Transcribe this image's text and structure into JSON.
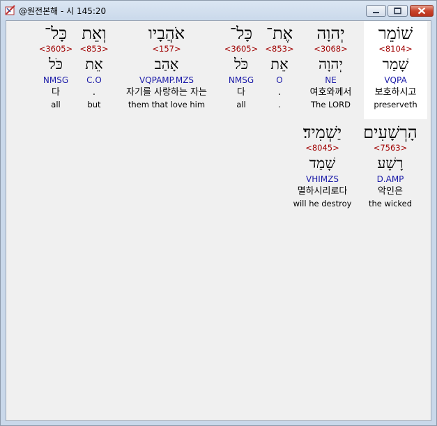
{
  "window": {
    "title": "@원전본해 - 시 145:20",
    "icon": "bible-tool-icon",
    "buttons": {
      "minimize": "minimize-icon",
      "maximize": "maximize-icon",
      "close": "close-icon"
    }
  },
  "words": [
    {
      "hebrew": "שׁוֹמֵר",
      "strong": "<8104>",
      "lemma": "שָׁמַר",
      "morph": "VQPA",
      "korean": "보호하시고",
      "english": "preserveth",
      "selected": true
    },
    {
      "hebrew": "יְהוָה",
      "strong": "<3068>",
      "lemma": "יְהוָה",
      "morph": "NE",
      "korean": "여호와께서",
      "english": "The LORD"
    },
    {
      "hebrew": "אֶת־",
      "strong": "<853>",
      "lemma": "אֵת",
      "morph": "O",
      "korean": ".",
      "english": "."
    },
    {
      "hebrew": "כָּל־",
      "strong": "<3605>",
      "lemma": "כֹּל",
      "morph": "NMSG",
      "korean": "다",
      "english": "all"
    },
    {
      "hebrew": "אֹהֲבָיו",
      "strong": "<157>",
      "lemma": "אָהַב",
      "morph": "VQPAMP.MZS",
      "korean": "자기를 사랑하는 자는",
      "english": "them that love him"
    },
    {
      "hebrew": "וְאֵת",
      "strong": "<853>",
      "lemma": "אֵת",
      "morph": "C.O",
      "korean": ".",
      "english": "but"
    },
    {
      "hebrew": "כָּל־",
      "strong": "<3605>",
      "lemma": "כֹּל",
      "morph": "NMSG",
      "korean": "다",
      "english": "all"
    },
    {
      "hebrew": "הָרְשָׁעִים",
      "strong": "<7563>",
      "lemma": "רָשָׁע",
      "morph": "D.AMP",
      "korean": "악인은",
      "english": "the wicked"
    },
    {
      "hebrew": "יַשְׁמִיד׃",
      "strong": "<8045>",
      "lemma": "שָׁמַד",
      "morph": "VHIMZS",
      "korean": "멸하시리로다",
      "english": "will he destroy"
    }
  ]
}
